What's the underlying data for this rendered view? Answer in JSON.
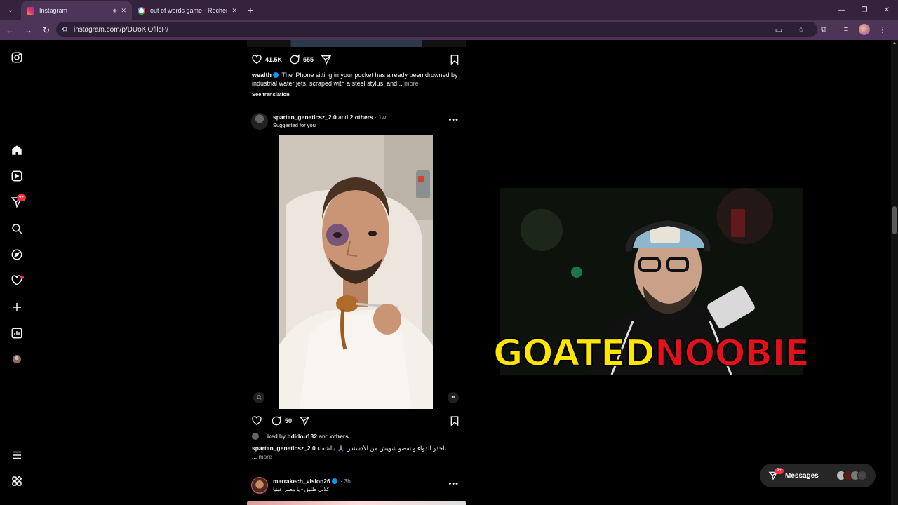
{
  "browser": {
    "tabs": [
      {
        "title": "Instagram",
        "active": true,
        "favicon": "instagram-icon"
      },
      {
        "title": "out of words game - Recherche",
        "active": false,
        "favicon": "google-icon"
      }
    ],
    "url": "instagram.com/p/DUoKiOfilcP/",
    "accent": "#35233e"
  },
  "sidebar": {
    "badge": "9+"
  },
  "post1": {
    "likes": "41.5K",
    "comments": "555",
    "author": "wealth",
    "caption": "The iPhone sitting in your pocket has already been drowned by industrial water jets, scraped with a steel stylus, and...",
    "more": "more",
    "see_translation": "See translation"
  },
  "post2": {
    "author": "spartan_geneticsz_2.0",
    "and": "and",
    "others_label": "2 others",
    "time": "1w",
    "subtitle": "Suggested for you",
    "comments": "50",
    "liked_prefix": "Liked by",
    "liked_user": "hdidou132",
    "liked_and": "and",
    "liked_others": "others",
    "caption_author": "spartan_geneticsz_2.0",
    "caption": "ناخدو الدواء و نقصو شويش من الأدسنس 🙏🏽 بالشفاء",
    "caption_more_prefix": "...",
    "caption_more": "more"
  },
  "post3": {
    "author": "marrakech_vision26",
    "time": "3h",
    "subtitle": "كلاني طليق • يا معمر عينيا"
  },
  "overlay": {
    "brand_part1": "GOATED",
    "brand_part2": "NOOBIE"
  },
  "messages": {
    "label": "Messages",
    "badge": "9+"
  }
}
